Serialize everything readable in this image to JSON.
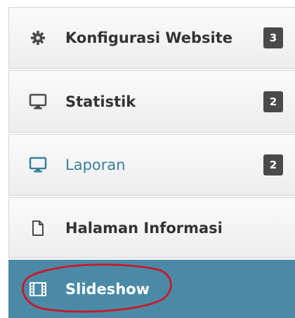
{
  "menu": {
    "items": [
      {
        "label": "Konfigurasi Website",
        "badge": "3",
        "icon": "gear-icon"
      },
      {
        "label": "Statistik",
        "badge": "2",
        "icon": "monitor-icon"
      },
      {
        "label": "Laporan",
        "badge": "2",
        "icon": "monitor-icon"
      },
      {
        "label": "Halaman Informasi",
        "icon": "document-icon"
      },
      {
        "label": "Slideshow",
        "icon": "film-icon",
        "active": true
      }
    ]
  },
  "colors": {
    "active_background": "#4b8aa6",
    "active_label_link": "#3b7e9d",
    "badge_background": "#4a4a4a",
    "annotation_stroke": "#c01f2f"
  }
}
